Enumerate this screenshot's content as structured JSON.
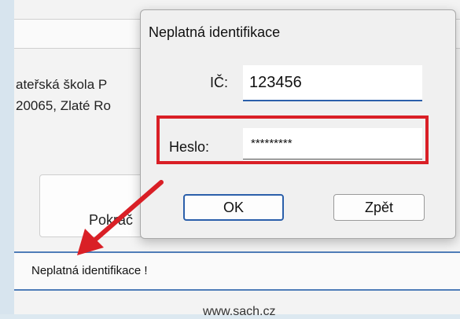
{
  "background": {
    "organization_line1": "ateřská škola P",
    "organization_line2": "20065, Zlaté Ro",
    "continue_button": "Pokrač",
    "status_message": "Neplatná identifikace !",
    "footer_url": "www.sach.cz"
  },
  "dialog": {
    "title": "Neplatná identifikace",
    "ic_label": "IČ:",
    "ic_value": "123456",
    "password_label": "Heslo:",
    "password_value": "*********",
    "ok_label": "OK",
    "back_label": "Zpět"
  },
  "annotations": {
    "highlight_color": "#d91f26",
    "arrow_color": "#d91f26"
  }
}
